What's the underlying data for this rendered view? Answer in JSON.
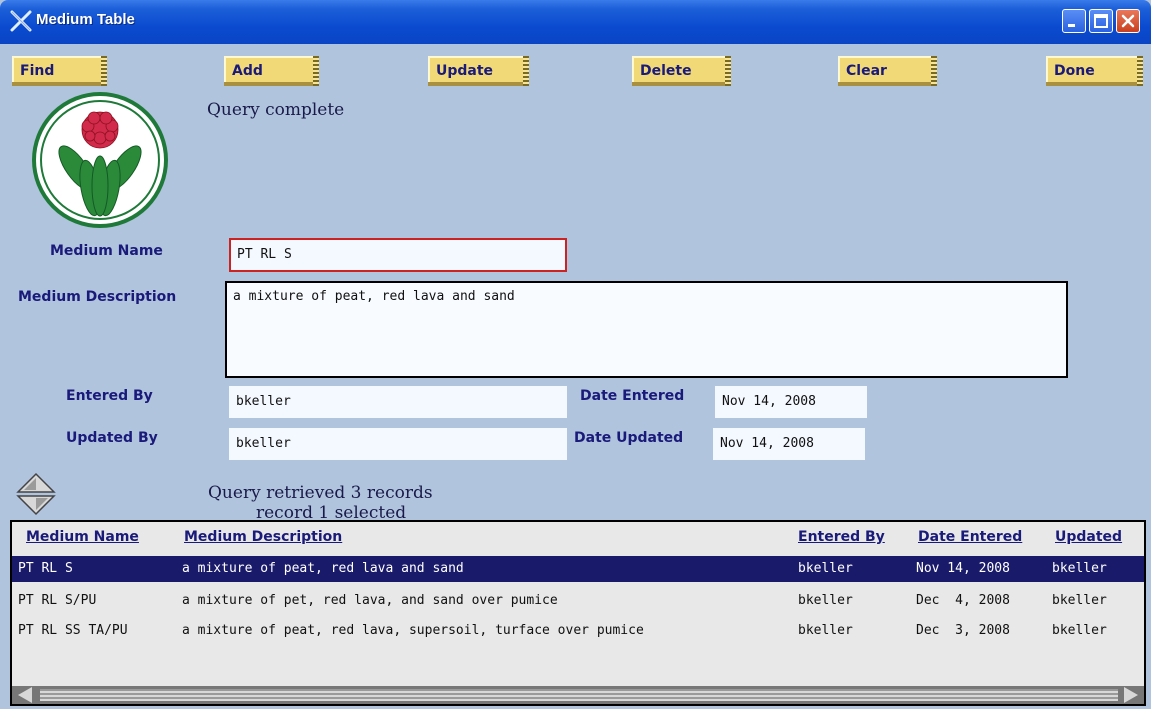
{
  "window": {
    "title": "Medium Table"
  },
  "toolbar": {
    "find": "Find",
    "add": "Add",
    "update": "Update",
    "delete": "Delete",
    "clear": "Clear",
    "done": "Done"
  },
  "status": {
    "message": "Query complete",
    "retrieved": "Query retrieved 3 records",
    "selected": "record 1 selected"
  },
  "form": {
    "medium_name_label": "Medium Name",
    "medium_name_value": "PT RL S",
    "medium_description_label": "Medium Description",
    "medium_description_value": "a mixture of peat, red lava and sand",
    "entered_by_label": "Entered By",
    "entered_by_value": "bkeller",
    "updated_by_label": "Updated By",
    "updated_by_value": "bkeller",
    "date_entered_label": "Date Entered",
    "date_entered_value": "Nov 14, 2008",
    "date_updated_label": "Date Updated",
    "date_updated_value": "Nov 14, 2008"
  },
  "table": {
    "headers": [
      "Medium Name",
      "Medium Description",
      "Entered By",
      "Date Entered",
      "Updated"
    ],
    "rows": [
      [
        "PT RL S",
        "a mixture of peat, red lava and sand",
        "bkeller",
        "Nov 14, 2008",
        "bkeller"
      ],
      [
        "PT RL S/PU",
        "a mixture of pet, red lava, and sand over pumice",
        "bkeller",
        "Dec  4, 2008",
        "bkeller"
      ],
      [
        "PT RL SS TA/PU",
        "a mixture of peat, red lava, supersoil, turface over pumice",
        "bkeller",
        "Dec  3, 2008",
        "bkeller"
      ]
    ],
    "selected_row": 0
  },
  "colors": {
    "background": "#b0c4de",
    "button": "#f2d978",
    "label": "#1a1a7a",
    "selected_row": "#1a1a6a"
  }
}
